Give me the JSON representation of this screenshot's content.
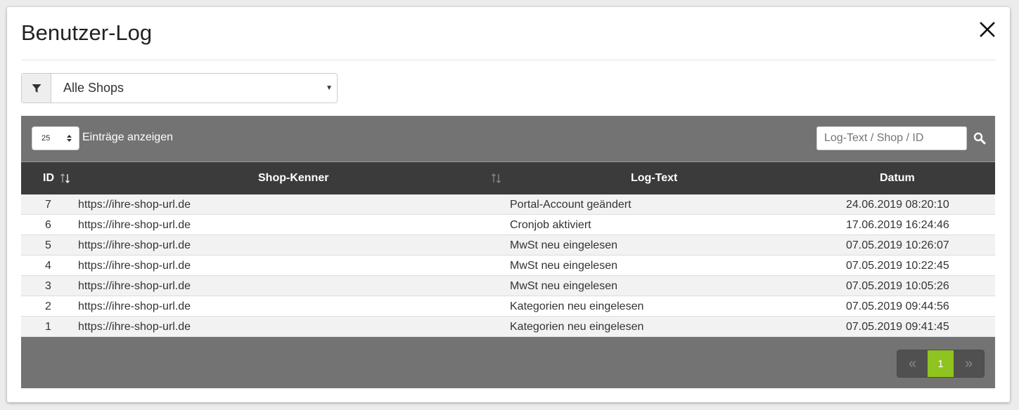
{
  "modal": {
    "title": "Benutzer-Log"
  },
  "filter": {
    "selected": "Alle Shops"
  },
  "table_controls": {
    "page_length": "25",
    "length_label": "Einträge anzeigen",
    "search_placeholder": "Log-Text / Shop / ID"
  },
  "table": {
    "columns": [
      "ID",
      "Shop-Kenner",
      "Log-Text",
      "Datum"
    ],
    "rows": [
      {
        "id": "7",
        "shop": "https://ihre-shop-url.de",
        "text": "Portal-Account geändert",
        "date": "24.06.2019 08:20:10"
      },
      {
        "id": "6",
        "shop": "https://ihre-shop-url.de",
        "text": "Cronjob aktiviert",
        "date": "17.06.2019 16:24:46"
      },
      {
        "id": "5",
        "shop": "https://ihre-shop-url.de",
        "text": "MwSt neu eingelesen",
        "date": "07.05.2019 10:26:07"
      },
      {
        "id": "4",
        "shop": "https://ihre-shop-url.de",
        "text": "MwSt neu eingelesen",
        "date": "07.05.2019 10:22:45"
      },
      {
        "id": "3",
        "shop": "https://ihre-shop-url.de",
        "text": "MwSt neu eingelesen",
        "date": "07.05.2019 10:05:26"
      },
      {
        "id": "2",
        "shop": "https://ihre-shop-url.de",
        "text": "Kategorien neu eingelesen",
        "date": "07.05.2019 09:44:56"
      },
      {
        "id": "1",
        "shop": "https://ihre-shop-url.de",
        "text": "Kategorien neu eingelesen",
        "date": "07.05.2019 09:41:45"
      }
    ]
  },
  "pagination": {
    "prev": "«",
    "current": "1",
    "next": "»"
  },
  "colors": {
    "panel_bg": "#737373",
    "header_bg": "#3b3b3b",
    "active_page": "#8fc320"
  }
}
